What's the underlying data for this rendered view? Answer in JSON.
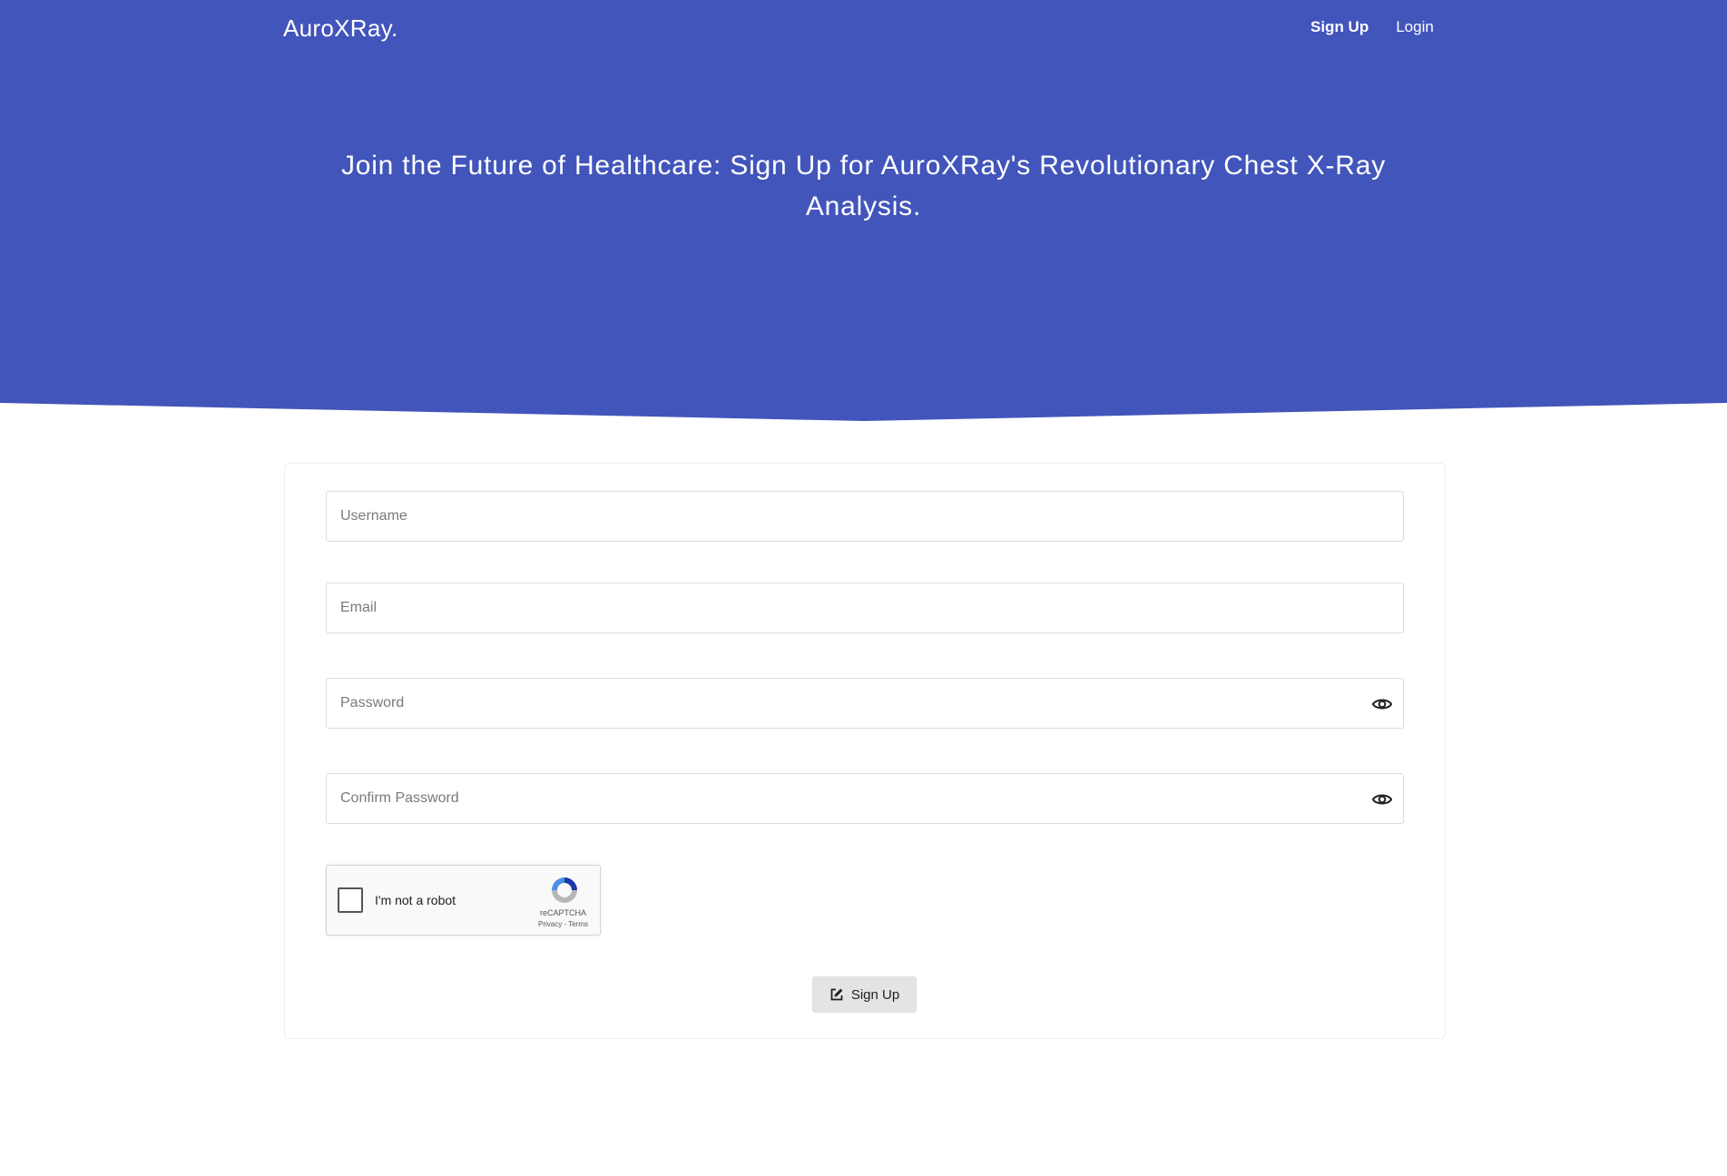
{
  "colors": {
    "hero": "#4255bb",
    "background": "#ffffff"
  },
  "nav": {
    "brand": "AuroXRay.",
    "links": [
      {
        "label": "Sign Up",
        "active": true
      },
      {
        "label": "Login",
        "active": false
      }
    ]
  },
  "hero": {
    "title": "Join the Future of Healthcare: Sign Up for AuroXRay's Revolutionary Chest X-Ray Analysis."
  },
  "form": {
    "username": {
      "placeholder": "Username",
      "value": ""
    },
    "email": {
      "placeholder": "Email",
      "value": ""
    },
    "password": {
      "placeholder": "Password",
      "value": "",
      "icon": "eye-icon"
    },
    "confirm_password": {
      "placeholder": "Confirm Password",
      "value": "",
      "icon": "eye-icon"
    },
    "captcha": {
      "label": "I'm not a robot",
      "brand": "reCAPTCHA",
      "links": "Privacy - Terms"
    },
    "submit": {
      "label": "Sign Up",
      "icon": "edit-icon"
    }
  }
}
